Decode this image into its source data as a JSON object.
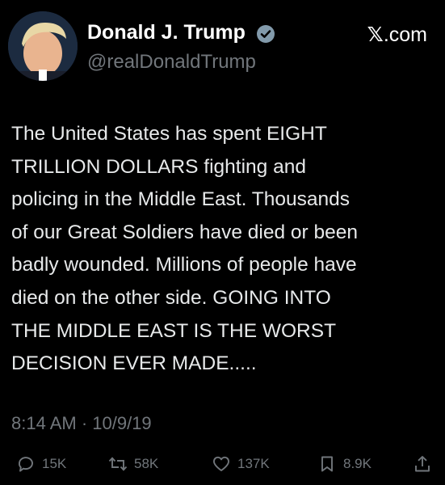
{
  "author": {
    "display_name": "Donald J. Trump",
    "handle": "@realDonaldTrump",
    "verified_icon": "verified-badge-icon"
  },
  "source": {
    "brand_x": "𝕏",
    "brand_suffix": ".com"
  },
  "tweet": {
    "lines": [
      "The United States has spent EIGHT",
      "TRILLION DOLLARS fighting and",
      "policing in the Middle East. Thousands",
      "of our Great Soldiers have died or been",
      "badly wounded. Millions of people have",
      "died on the other side. GOING INTO",
      "THE MIDDLE EAST IS THE WORST",
      "DECISION EVER MADE....."
    ]
  },
  "meta": {
    "timestamp": "8:14 AM · 10/9/19"
  },
  "actions": {
    "replies": "15K",
    "reposts": "58K",
    "likes": "137K",
    "bookmarks": "8.9K"
  },
  "colors": {
    "background": "#000000",
    "text": "#e7e9ea",
    "muted": "#71767b",
    "verified": "#829aab"
  }
}
